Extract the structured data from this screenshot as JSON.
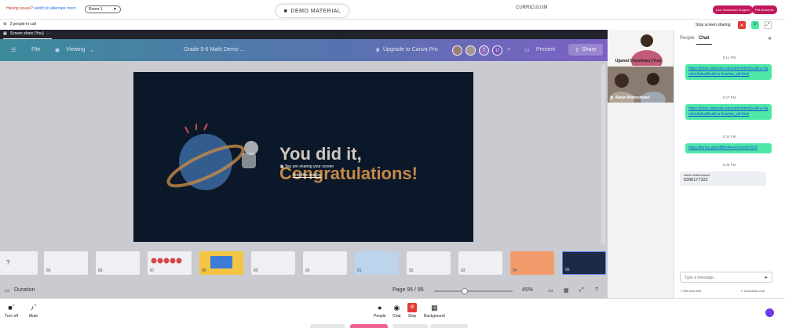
{
  "topbar": {
    "issues_text": "Having issues?",
    "issues_link": "switch to alternate room",
    "room_label": "Room 1",
    "demo_material": "DEMO MATERIAL",
    "curriculum": "CURRICULUM",
    "live_support": "Live Classroom Support",
    "pm_moments": "PM Moments"
  },
  "callbar": {
    "people_in_call": "2 people in call",
    "stop_sharing": "Stop screen sharing",
    "p_badge": "P"
  },
  "share": {
    "tab_label": "Screen share (You)",
    "canva": {
      "file": "File",
      "viewing": "Viewing",
      "doc_title": "Grade 5-6 Math Demo ...",
      "upgrade": "Upgrade to Canva Pro",
      "avatar_t": "T",
      "avatar_u": "U",
      "present": "Present",
      "share": "Share"
    },
    "slide": {
      "line1": "You did it,",
      "line2": "Congratulations!"
    },
    "overlay": {
      "sharing": "You are sharing your screen",
      "hide": "Hide this overlay"
    },
    "thumbs": [
      "85",
      "86",
      "87",
      "88",
      "89",
      "90",
      "91",
      "92",
      "93",
      "94",
      "95"
    ],
    "bottom": {
      "duration": "Duration",
      "page": "Page 95 / 95",
      "zoom": "45%"
    }
  },
  "videos": [
    {
      "name": "Ujjawal Choudhary (You)"
    },
    {
      "name": "Aarav Maheshwari"
    }
  ],
  "chat": {
    "tab_people": "People",
    "tab_chat": "Chat",
    "messages": [
      {
        "time": "8:11 PM",
        "text": "https://phet.colorado.edu/sims/html/build-a-fraction/latest/build-a-fraction_all.html"
      },
      {
        "time": "8:27 PM",
        "text": "https://phet.colorado.edu/sims/html/build-a-fraction/latest/build-a-fraction_all.html"
      },
      {
        "time": "8:34 PM",
        "text": "https://forms.gle/x8Bm4revFXxmKYXc9"
      },
      {
        "time": "8:46 PM",
        "sender": "Aarav Maheshwari",
        "text": "6396177322"
      }
    ],
    "input_placeholder": "Type a message...",
    "char_limit": "256 char limit",
    "download": "Download chat"
  },
  "toolbar": {
    "turn_off": "Turn off",
    "mute": "Mute",
    "people": "People",
    "chat": "Chat",
    "stop": "Stop",
    "background": "Background"
  },
  "colors": {
    "accent_green": "#4de8a8",
    "danger": "#e53935",
    "brand_pink": "#c2185b"
  }
}
